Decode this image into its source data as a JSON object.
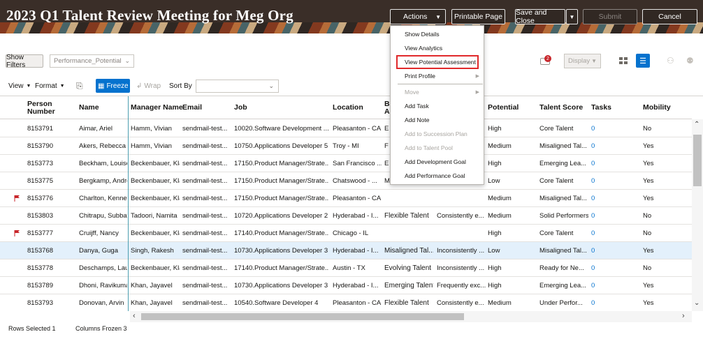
{
  "header": {
    "title": "2023 Q1 Talent Review Meeting for Meg Org",
    "actions_label": "Actions",
    "printable_label": "Printable Page",
    "save_close_label": "Save and Close",
    "submit_label": "Submit",
    "cancel_label": "Cancel"
  },
  "toolbar": {
    "show_filters": "Show Filters",
    "view_select": "Performance_Potential",
    "notif_count": "2",
    "display_label": "Display"
  },
  "toolbar2": {
    "view": "View",
    "format": "Format",
    "freeze": "Freeze",
    "wrap": "Wrap",
    "sort_by": "Sort By"
  },
  "columns": [
    "Person Number",
    "Name",
    "Manager Name",
    "Email",
    "Job",
    "Location",
    "Ba As",
    "",
    "Potential",
    "Talent Score",
    "Tasks",
    "Mobility"
  ],
  "rows": [
    {
      "num": "8153791",
      "name": "Aimar, Ariel",
      "mgr": "Hamm, Vivian",
      "email": "sendmail-test...",
      "job": "10020.Software Development ...",
      "loc": "Pleasanton - CA",
      "ba": "E",
      "perf": "",
      "pot": "High",
      "ts": "Core Talent",
      "tasks": "0",
      "mob": "No",
      "flag": false
    },
    {
      "num": "8153790",
      "name": "Akers, Rebecca",
      "mgr": "Hamm, Vivian",
      "email": "sendmail-test...",
      "job": "10750.Applications Developer 5",
      "loc": "Troy - MI",
      "ba": "F",
      "perf": "",
      "pot": "Medium",
      "ts": "Misaligned Tal...",
      "tasks": "0",
      "mob": "Yes",
      "flag": false
    },
    {
      "num": "8153773",
      "name": "Beckham, Louise",
      "mgr": "Beckenbauer, Kla",
      "email": "sendmail-test...",
      "job": "17150.Product Manager/Strate...",
      "loc": "San Francisco ...",
      "ba": "E",
      "perf": "",
      "pot": "High",
      "ts": "Emerging Lea...",
      "tasks": "0",
      "mob": "Yes",
      "flag": false
    },
    {
      "num": "8153775",
      "name": "Bergkamp, Andre",
      "mgr": "Beckenbauer, Kla",
      "email": "sendmail-test...",
      "job": "17150.Product Manager/Strate...",
      "loc": "Chatswood - ...",
      "ba": "M",
      "perf": "",
      "pot": "Low",
      "ts": "Core Talent",
      "tasks": "0",
      "mob": "Yes",
      "flag": false
    },
    {
      "num": "8153776",
      "name": "Charlton, Kenneth",
      "mgr": "Beckenbauer, Kla",
      "email": "sendmail-test...",
      "job": "17150.Product Manager/Strate...",
      "loc": "Pleasanton - CA",
      "ba": "",
      "perf": "",
      "pot": "Medium",
      "ts": "Misaligned Tal...",
      "tasks": "0",
      "mob": "Yes",
      "flag": true
    },
    {
      "num": "8153803",
      "name": "Chitrapu, Subbaf",
      "mgr": "Tadoori, Namita",
      "email": "sendmail-test...",
      "job": "10720.Applications Developer 2",
      "loc": "Hyderabad - I...",
      "ba": "Flexible Talent",
      "perf": "Consistently e...",
      "pot": "Medium",
      "ts": "Solid Performers",
      "tasks": "0",
      "mob": "No",
      "flag": false
    },
    {
      "num": "8153777",
      "name": "Cruijff, Nancy",
      "mgr": "Beckenbauer, Kla",
      "email": "sendmail-test...",
      "job": "17140.Product Manager/Strate...",
      "loc": "Chicago - IL",
      "ba": "",
      "perf": "",
      "pot": "High",
      "ts": "Core Talent",
      "tasks": "0",
      "mob": "No",
      "flag": true
    },
    {
      "num": "8153768",
      "name": "Danya, Guga",
      "mgr": "Singh, Rakesh",
      "email": "sendmail-test...",
      "job": "10730.Applications Developer 3",
      "loc": "Hyderabad - I...",
      "ba": "Misaligned Tal...",
      "perf": "Inconsistently ...",
      "pot": "Low",
      "ts": "Misaligned Tal...",
      "tasks": "0",
      "mob": "Yes",
      "flag": false,
      "sel": true
    },
    {
      "num": "8153778",
      "name": "Deschamps, Lau",
      "mgr": "Beckenbauer, Kla",
      "email": "sendmail-test...",
      "job": "17140.Product Manager/Strate...",
      "loc": "Austin - TX",
      "ba": "Evolving Talent",
      "perf": "Inconsistently ...",
      "pot": "High",
      "ts": "Ready for Ne...",
      "tasks": "0",
      "mob": "No",
      "flag": false
    },
    {
      "num": "8153789",
      "name": "Dhoni, Ravikuma",
      "mgr": "Khan, Jayavel",
      "email": "sendmail-test...",
      "job": "10730.Applications Developer 3",
      "loc": "Hyderabad - I...",
      "ba": "Emerging Talent",
      "perf": "Frequently exc...",
      "pot": "High",
      "ts": "Emerging Lea...",
      "tasks": "0",
      "mob": "Yes",
      "flag": false
    },
    {
      "num": "8153793",
      "name": "Donovan, Arvin",
      "mgr": "Khan, Jayavel",
      "email": "sendmail-test...",
      "job": "10540.Software Developer 4",
      "loc": "Pleasanton - CA",
      "ba": "Flexible Talent",
      "perf": "Consistently e...",
      "pot": "Medium",
      "ts": "Under Perfor...",
      "tasks": "0",
      "mob": "Yes",
      "flag": false
    }
  ],
  "menu": {
    "items": [
      {
        "label": "Show Details",
        "disabled": false,
        "sub": false
      },
      {
        "label": "View Analytics",
        "disabled": false,
        "sub": false
      },
      {
        "label": "View Potential Assessment",
        "disabled": false,
        "sub": false,
        "highlight": true
      },
      {
        "label": "Print Profile",
        "disabled": false,
        "sub": true
      },
      {
        "label": "Move",
        "disabled": true,
        "sub": true
      },
      {
        "label": "Add Task",
        "disabled": false,
        "sub": false
      },
      {
        "label": "Add Note",
        "disabled": false,
        "sub": false
      },
      {
        "label": "Add to Succession Plan",
        "disabled": true,
        "sub": false
      },
      {
        "label": "Add to Talent Pool",
        "disabled": true,
        "sub": false
      },
      {
        "label": "Add Development Goal",
        "disabled": false,
        "sub": false
      },
      {
        "label": "Add Performance Goal",
        "disabled": false,
        "sub": false
      }
    ]
  },
  "status": {
    "rows_selected": "Rows Selected 1",
    "columns_frozen": "Columns Frozen 3"
  }
}
